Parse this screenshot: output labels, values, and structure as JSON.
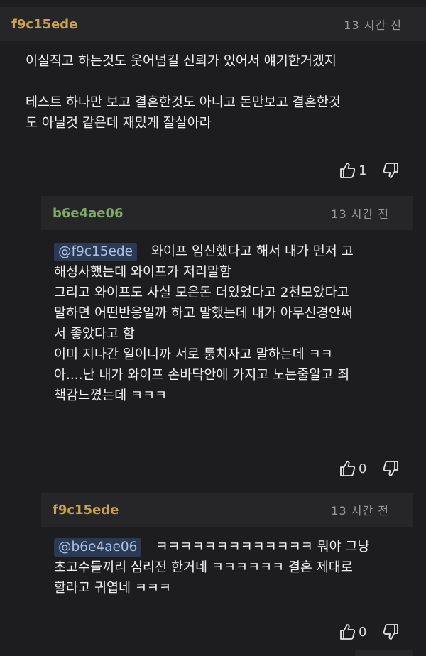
{
  "comments": [
    {
      "user": "f9c15ede",
      "time": "13 시간 전",
      "lines": [
        "이실직고 하는것도 웃어넘길 신뢰가 있어서 얘기한거겠지",
        "",
        "테스트 하나만 보고 결혼한것도 아니고 돈만보고 결혼한것",
        "도 아닐것 같은데 재밌게 잘살아라"
      ],
      "likes": "1"
    },
    {
      "user": "b6e4ae06",
      "time": "13 시간 전",
      "mention": "@f9c15ede",
      "lines": [
        "와이프 임신했다고 해서 내가 먼저 고",
        "해성사했는데 와이프가 저리말함",
        "그리고 와이프도 사실 모은돈 더있었다고 2천모았다고",
        "말하면 어떤반응일까 하고 말했는데 내가 아무신경안써",
        "서 좋았다고 함",
        "이미 지나간 일이니까 서로 퉁치자고 말하는데 ㅋㅋ",
        "아....난 내가 와이프 손바닥안에 가지고 노는줄알고 죄",
        "책감느꼈는데 ㅋㅋㅋ"
      ],
      "likes": "0"
    },
    {
      "user": "f9c15ede",
      "time": "13 시간 전",
      "mention": "@b6e4ae06",
      "lines": [
        "ㅋㅋㅋㅋㅋㅋㅋㅋㅋㅋㅋㅋㅋ 뭐야 그냥",
        "초고수들끼리 심리전 한거네 ㅋㅋㅋㅋㅋㅋ 결혼 제대로",
        "할라고 귀엽네 ㅋㅋㅋ"
      ],
      "likes": "0"
    }
  ],
  "colors": {
    "background": "#1d1d1f",
    "header_bg": "#262628",
    "username_gold": "#c9a24a",
    "username_green": "#7faa6a",
    "mention_bg": "#2b3a52"
  },
  "icons": [
    "thumbs-up-icon",
    "thumbs-down-icon"
  ]
}
